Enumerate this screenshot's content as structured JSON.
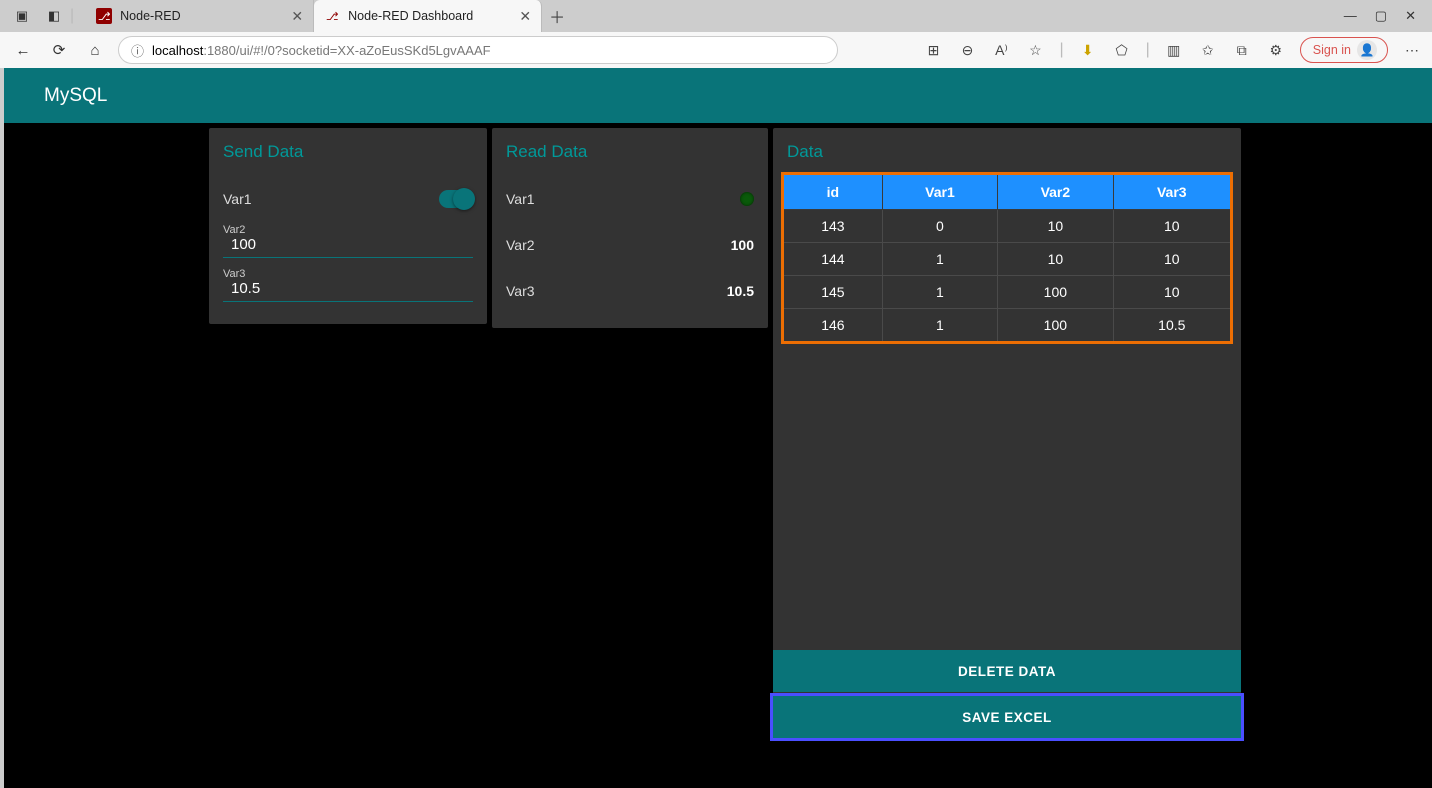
{
  "browser": {
    "tabs": [
      {
        "title": "Node-RED",
        "active": false
      },
      {
        "title": "Node-RED Dashboard",
        "active": true
      }
    ],
    "url_host": "localhost",
    "url_path": ":1880/ui/#!/0?socketid=XX-aZoEusSKd5LgvAAAF",
    "signin": "Sign in"
  },
  "page": {
    "title": "MySQL"
  },
  "send": {
    "title": "Send Data",
    "var1_label": "Var1",
    "var1_on": true,
    "var2_label": "Var2",
    "var2_value": "100",
    "var3_label": "Var3",
    "var3_value": "10.5"
  },
  "read": {
    "title": "Read Data",
    "var1_label": "Var1",
    "var2_label": "Var2",
    "var2_value": "100",
    "var3_label": "Var3",
    "var3_value": "10.5"
  },
  "data": {
    "title": "Data",
    "headers": [
      "id",
      "Var1",
      "Var2",
      "Var3"
    ],
    "rows": [
      [
        "143",
        "0",
        "10",
        "10"
      ],
      [
        "144",
        "1",
        "10",
        "10"
      ],
      [
        "145",
        "1",
        "100",
        "10"
      ],
      [
        "146",
        "1",
        "100",
        "10.5"
      ]
    ],
    "delete_label": "DELETE DATA",
    "save_label": "SAVE EXCEL"
  }
}
